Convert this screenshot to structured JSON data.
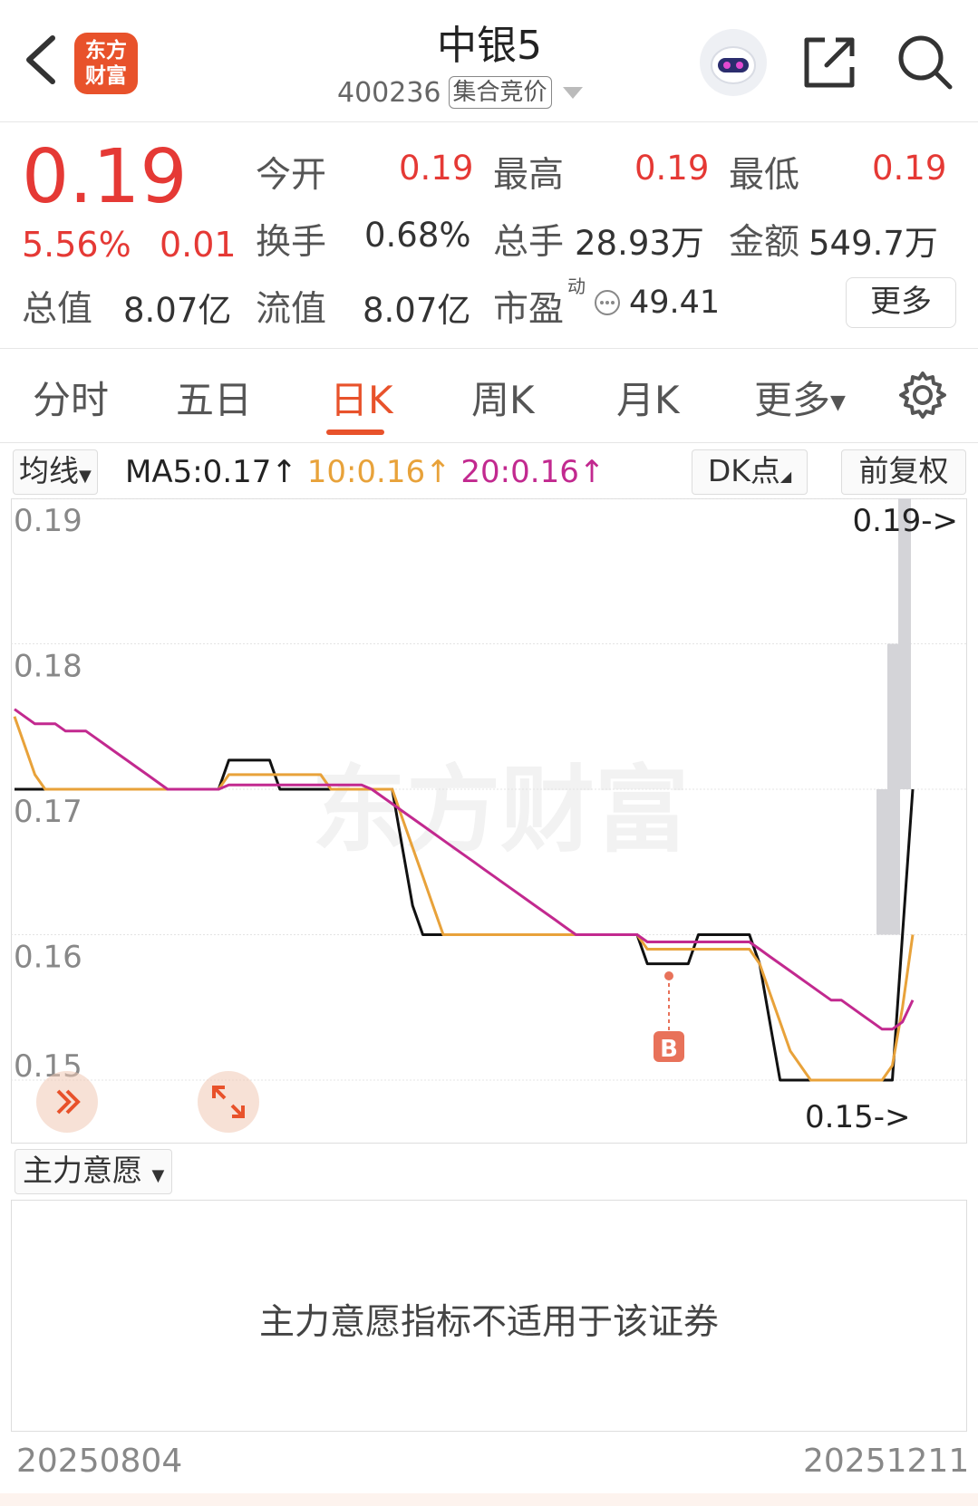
{
  "header": {
    "logo_line1": "东方",
    "logo_line2": "财富",
    "stock_name": "中银5",
    "stock_code": "400236",
    "auction_tag": "集合竞价"
  },
  "quote": {
    "price": "0.19",
    "change_pct": "5.56%",
    "change": "0.01",
    "open_label": "今开",
    "open": "0.19",
    "high_label": "最高",
    "high": "0.19",
    "low_label": "最低",
    "low": "0.19",
    "turnover_label": "换手",
    "turnover": "0.68%",
    "volume_label": "总手",
    "volume": "28.93万",
    "amount_label": "金额",
    "amount": "549.7万",
    "mktcap_label": "总值",
    "mktcap": "8.07亿",
    "float_label": "流值",
    "float_cap": "8.07亿",
    "pe_label": "市盈",
    "pe_sup": "动",
    "pe": "49.41",
    "more_label": "更多"
  },
  "tabs": [
    {
      "label": "分时"
    },
    {
      "label": "五日"
    },
    {
      "label": "日K"
    },
    {
      "label": "周K"
    },
    {
      "label": "月K"
    },
    {
      "label": "更多"
    }
  ],
  "indicator_bar": {
    "ma_select": "均线",
    "ma5": "MA5:0.17↑",
    "ma10": "10:0.16↑",
    "ma20": "20:0.16↑",
    "dk_label": "DK点",
    "adjust_label": "前复权"
  },
  "colors": {
    "up": "#e53935",
    "accent": "#e8522b",
    "ma5": "#111111",
    "ma10": "#e8a23a",
    "ma20": "#c2298f"
  },
  "chart_data": {
    "type": "line",
    "y_ticks": [
      "0.19",
      "0.18",
      "0.17",
      "0.16",
      "0.15"
    ],
    "ylim": [
      0.15,
      0.19
    ],
    "max_label": "0.19->",
    "min_label": "0.15->",
    "watermark": "东方财富",
    "signal_label": "B",
    "x_start": "20250804",
    "x_end": "20251211",
    "series": [
      {
        "name": "MA5",
        "values": [
          0.17,
          0.17,
          0.17,
          0.17,
          0.17,
          0.17,
          0.17,
          0.17,
          0.17,
          0.17,
          0.17,
          0.17,
          0.17,
          0.17,
          0.17,
          0.17,
          0.17,
          0.17,
          0.17,
          0.17,
          0.17,
          0.172,
          0.172,
          0.172,
          0.172,
          0.172,
          0.17,
          0.17,
          0.17,
          0.17,
          0.17,
          0.17,
          0.17,
          0.17,
          0.17,
          0.17,
          0.17,
          0.17,
          0.166,
          0.162,
          0.16,
          0.16,
          0.16,
          0.16,
          0.16,
          0.16,
          0.16,
          0.16,
          0.16,
          0.16,
          0.16,
          0.16,
          0.16,
          0.16,
          0.16,
          0.16,
          0.16,
          0.16,
          0.16,
          0.16,
          0.16,
          0.16,
          0.158,
          0.158,
          0.158,
          0.158,
          0.158,
          0.16,
          0.16,
          0.16,
          0.16,
          0.16,
          0.16,
          0.158,
          0.154,
          0.15,
          0.15,
          0.15,
          0.15,
          0.15,
          0.15,
          0.15,
          0.15,
          0.15,
          0.15,
          0.15,
          0.15,
          0.16,
          0.17
        ]
      },
      {
        "name": "MA10",
        "values": [
          0.175,
          0.173,
          0.171,
          0.17,
          0.17,
          0.17,
          0.17,
          0.17,
          0.17,
          0.17,
          0.17,
          0.17,
          0.17,
          0.17,
          0.17,
          0.17,
          0.17,
          0.17,
          0.17,
          0.17,
          0.17,
          0.171,
          0.171,
          0.171,
          0.171,
          0.171,
          0.171,
          0.171,
          0.171,
          0.171,
          0.171,
          0.17,
          0.17,
          0.17,
          0.17,
          0.17,
          0.17,
          0.17,
          0.168,
          0.166,
          0.164,
          0.162,
          0.16,
          0.16,
          0.16,
          0.16,
          0.16,
          0.16,
          0.16,
          0.16,
          0.16,
          0.16,
          0.16,
          0.16,
          0.16,
          0.16,
          0.16,
          0.16,
          0.16,
          0.16,
          0.16,
          0.16,
          0.159,
          0.159,
          0.159,
          0.159,
          0.159,
          0.159,
          0.159,
          0.159,
          0.159,
          0.159,
          0.159,
          0.158,
          0.156,
          0.154,
          0.152,
          0.151,
          0.15,
          0.15,
          0.15,
          0.15,
          0.15,
          0.15,
          0.15,
          0.15,
          0.151,
          0.155,
          0.16
        ]
      },
      {
        "name": "MA20",
        "values": [
          0.1755,
          0.175,
          0.1745,
          0.1745,
          0.1745,
          0.174,
          0.174,
          0.174,
          0.1735,
          0.173,
          0.1725,
          0.172,
          0.1715,
          0.171,
          0.1705,
          0.17,
          0.17,
          0.17,
          0.17,
          0.17,
          0.17,
          0.1703,
          0.1703,
          0.1703,
          0.1703,
          0.1703,
          0.1703,
          0.1703,
          0.1703,
          0.1703,
          0.1703,
          0.1703,
          0.1703,
          0.1703,
          0.1703,
          0.17,
          0.1695,
          0.169,
          0.1685,
          0.168,
          0.1675,
          0.167,
          0.1665,
          0.166,
          0.1655,
          0.165,
          0.1645,
          0.164,
          0.1635,
          0.163,
          0.1625,
          0.162,
          0.1615,
          0.161,
          0.1605,
          0.16,
          0.16,
          0.16,
          0.16,
          0.16,
          0.16,
          0.16,
          0.1595,
          0.1595,
          0.1595,
          0.1595,
          0.1595,
          0.1595,
          0.1595,
          0.1595,
          0.1595,
          0.1595,
          0.1595,
          0.159,
          0.1585,
          0.158,
          0.1575,
          0.157,
          0.1565,
          0.156,
          0.1555,
          0.1555,
          0.155,
          0.1545,
          0.154,
          0.1535,
          0.1535,
          0.154,
          0.1555
        ]
      }
    ]
  },
  "main_force": {
    "select_label": "主力意愿",
    "message": "主力意愿指标不适用于该证券"
  }
}
